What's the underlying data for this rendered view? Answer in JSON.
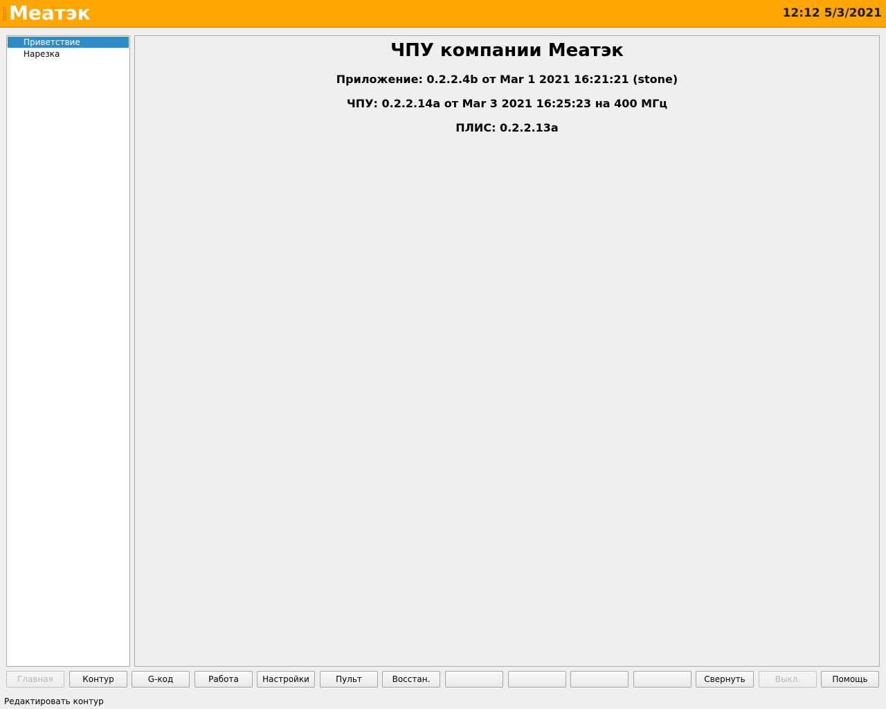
{
  "header": {
    "app_title": "Меатэк",
    "clock": "12:12 5/3/2021"
  },
  "sidebar": {
    "items": [
      {
        "label": "Приветствие",
        "active": true
      },
      {
        "label": "Нарезка",
        "active": false
      }
    ]
  },
  "main": {
    "heading": "ЧПУ компании Меатэк",
    "app_version": "Приложение: 0.2.2.4b от Mar 1 2021 16:21:21 (stone)",
    "cnc_version": "ЧПУ: 0.2.2.14a от Mar 3 2021 16:25:23 на 400 МГц",
    "fpga_version": "ПЛИС: 0.2.2.13a"
  },
  "buttons": [
    {
      "label": "Главная",
      "enabled": false
    },
    {
      "label": "Контур",
      "enabled": true
    },
    {
      "label": "G-код",
      "enabled": true
    },
    {
      "label": "Работа",
      "enabled": true
    },
    {
      "label": "Настройки",
      "enabled": true
    },
    {
      "label": "Пульт",
      "enabled": true
    },
    {
      "label": "Восстан.",
      "enabled": true
    },
    {
      "label": "",
      "enabled": true
    },
    {
      "label": "",
      "enabled": true
    },
    {
      "label": "",
      "enabled": true
    },
    {
      "label": "",
      "enabled": true
    },
    {
      "label": "Свернуть",
      "enabled": true
    },
    {
      "label": "Выкл.",
      "enabled": false
    },
    {
      "label": "Помощь",
      "enabled": true
    }
  ],
  "status_bar": {
    "text": "Редактировать контур"
  },
  "colors": {
    "titlebar": "#ffa600",
    "selection": "#308cc6"
  }
}
